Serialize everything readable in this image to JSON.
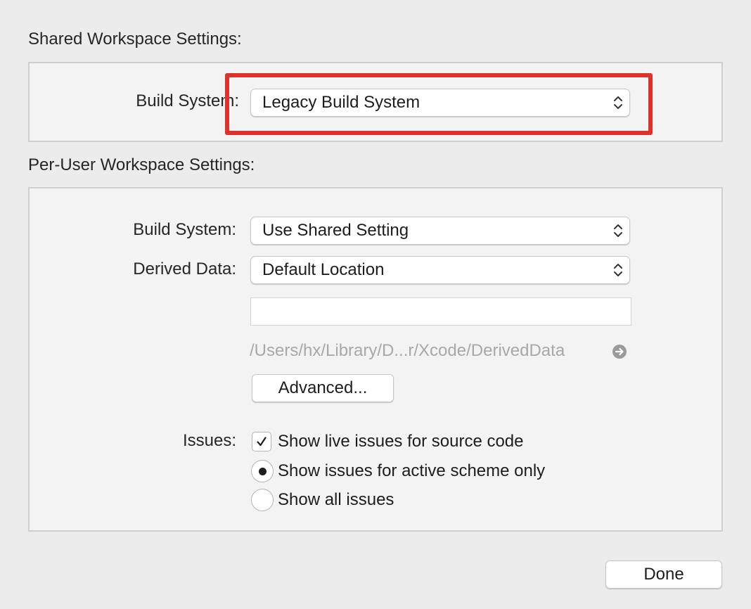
{
  "shared": {
    "title": "Shared Workspace Settings:",
    "build_system_label": "Build System:",
    "build_system_value": "Legacy Build System"
  },
  "per_user": {
    "title": "Per-User Workspace Settings:",
    "build_system_label": "Build System:",
    "build_system_value": "Use Shared Setting",
    "derived_data_label": "Derived Data:",
    "derived_data_value": "Default Location",
    "derived_data_custom_path": "",
    "derived_data_path": "/Users/hx/Library/D...r/Xcode/DerivedData",
    "advanced_label": "Advanced...",
    "issues_label": "Issues:",
    "issues_options": [
      {
        "label": "Show live issues for source code",
        "type": "checkbox",
        "checked": true
      },
      {
        "label": "Show issues for active scheme only",
        "type": "radio",
        "checked": true
      },
      {
        "label": "Show all issues",
        "type": "radio",
        "checked": false
      }
    ]
  },
  "footer": {
    "done_label": "Done"
  },
  "icons": {
    "popup_arrows": "up-down-chevron-icon",
    "reveal": "arrow-circle-right-icon",
    "checkmark": "checkmark-icon"
  },
  "colors": {
    "highlight": "#e0302a",
    "background": "#ececec",
    "path_text": "#a8a8a8"
  }
}
